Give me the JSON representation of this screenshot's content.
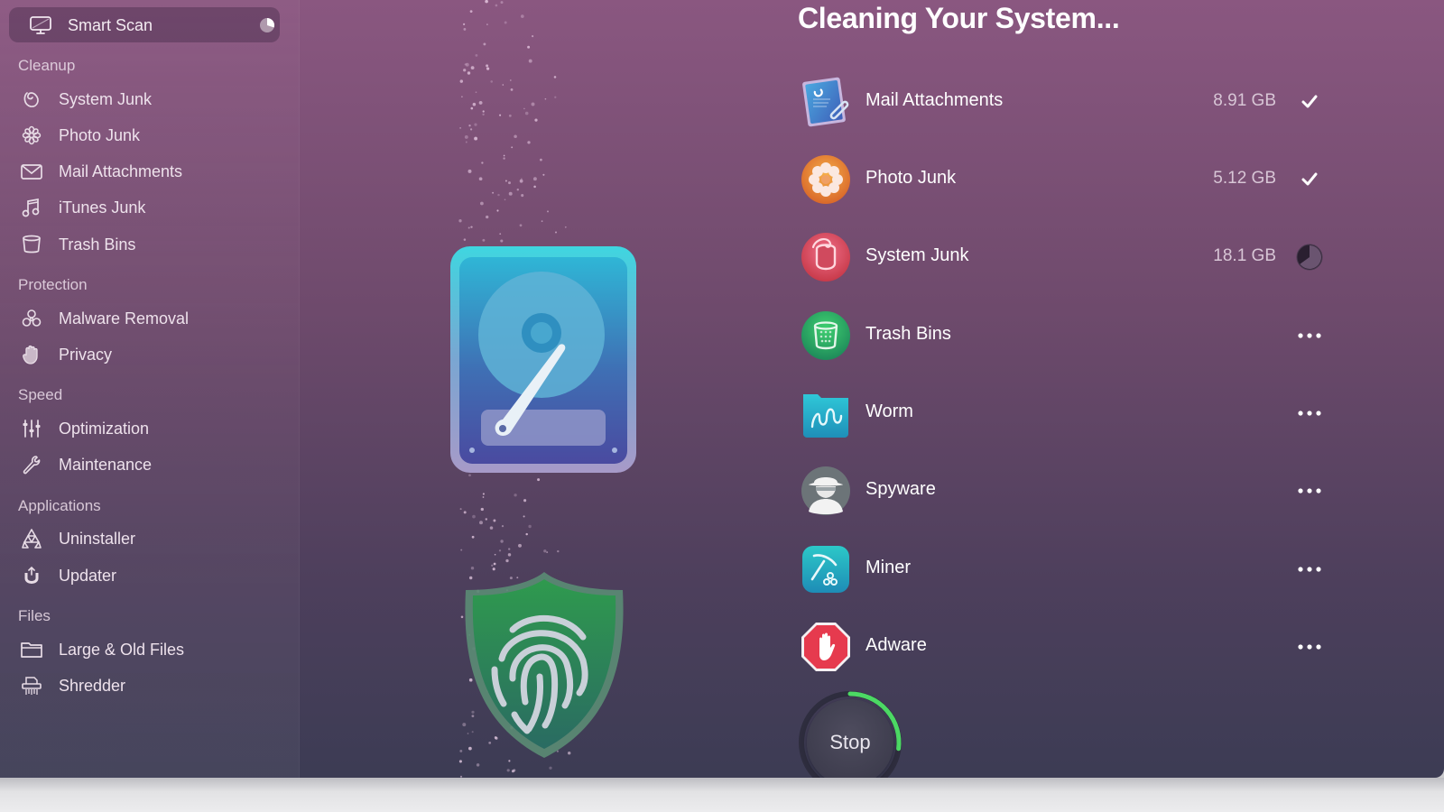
{
  "sidebar": {
    "smart_scan": {
      "label": "Smart Scan",
      "icon": "monitor-icon",
      "status_icon": "pie-progress-icon"
    },
    "sections": [
      {
        "title": "Cleanup",
        "items": [
          {
            "label": "System Junk",
            "icon": "system-junk-icon"
          },
          {
            "label": "Photo Junk",
            "icon": "flower-icon"
          },
          {
            "label": "Mail Attachments",
            "icon": "envelope-icon"
          },
          {
            "label": "iTunes Junk",
            "icon": "music-note-icon"
          },
          {
            "label": "Trash Bins",
            "icon": "trash-bin-icon"
          }
        ]
      },
      {
        "title": "Protection",
        "items": [
          {
            "label": "Malware Removal",
            "icon": "biohazard-icon"
          },
          {
            "label": "Privacy",
            "icon": "hand-icon"
          }
        ]
      },
      {
        "title": "Speed",
        "items": [
          {
            "label": "Optimization",
            "icon": "sliders-icon"
          },
          {
            "label": "Maintenance",
            "icon": "wrench-icon"
          }
        ]
      },
      {
        "title": "Applications",
        "items": [
          {
            "label": "Uninstaller",
            "icon": "uninstaller-icon"
          },
          {
            "label": "Updater",
            "icon": "updater-icon"
          }
        ]
      },
      {
        "title": "Files",
        "items": [
          {
            "label": "Large & Old Files",
            "icon": "folder-icon"
          },
          {
            "label": "Shredder",
            "icon": "shredder-icon"
          }
        ]
      }
    ]
  },
  "main": {
    "title": "Cleaning Your System...",
    "tasks": [
      {
        "label": "Mail Attachments",
        "size": "8.91 GB",
        "status": "done",
        "icon": "mail-attachment-icon"
      },
      {
        "label": "Photo Junk",
        "size": "5.12 GB",
        "status": "done",
        "icon": "photo-junk-icon"
      },
      {
        "label": "System Junk",
        "size": "18.1 GB",
        "status": "in-progress",
        "icon": "system-junk-icon"
      },
      {
        "label": "Trash Bins",
        "size": "",
        "status": "pending",
        "icon": "trash-bins-icon"
      },
      {
        "label": "Worm",
        "size": "",
        "status": "pending",
        "icon": "worm-icon"
      },
      {
        "label": "Spyware",
        "size": "",
        "status": "pending",
        "icon": "spyware-icon"
      },
      {
        "label": "Miner",
        "size": "",
        "status": "pending",
        "icon": "miner-icon"
      },
      {
        "label": "Adware",
        "size": "",
        "status": "pending",
        "icon": "adware-icon"
      }
    ],
    "stop_button": {
      "label": "Stop",
      "progress": 0.27
    },
    "system_junk_progress": 0.65,
    "smart_scan_progress": 0.3
  },
  "colors": {
    "progress_green": "#4cd964",
    "check_white": "#ffffff"
  }
}
